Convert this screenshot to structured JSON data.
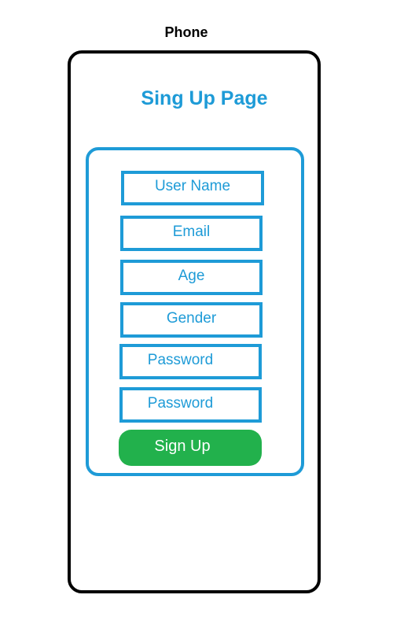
{
  "caption": "Phone",
  "page_title": "Sing Up Page",
  "form": {
    "fields": [
      {
        "label": "User Name"
      },
      {
        "label": "Email"
      },
      {
        "label": "Age"
      },
      {
        "label": "Gender"
      },
      {
        "label": "Password"
      },
      {
        "label": "Password"
      }
    ],
    "submit_label": "Sign Up"
  },
  "colors": {
    "accent": "#1e9bd7",
    "button": "#22b14c",
    "frame": "#000000"
  }
}
